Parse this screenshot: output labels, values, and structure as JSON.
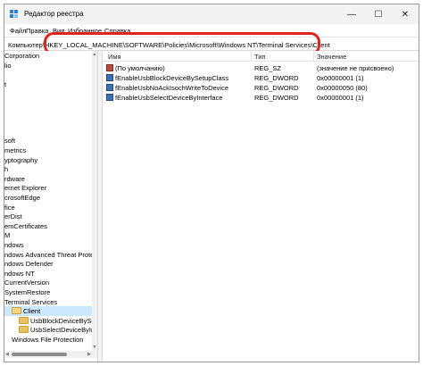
{
  "window": {
    "title": "Редактор реестра",
    "min_glyph": "—",
    "max_glyph": "☐",
    "close_glyph": "✕",
    "icon": "registry-editor-icon"
  },
  "menu": [
    "Файл",
    "Правка",
    "Вид",
    "Избранное",
    "Справка"
  ],
  "address": {
    "value": "Компьютер\\HKEY_LOCAL_MACHINE\\SOFTWARE\\Policies\\Microsoft\\Windows NT\\Terminal Services\\Client"
  },
  "tree": {
    "items": [
      {
        "label": "Corporation"
      },
      {
        "label": "lio"
      },
      {
        "label": ""
      },
      {
        "label": "t"
      },
      {
        "label": ""
      },
      {
        "label": ""
      },
      {
        "label": ""
      },
      {
        "label": ""
      },
      {
        "label": ""
      },
      {
        "label": "soft"
      },
      {
        "label": "metrics"
      },
      {
        "label": "yptography"
      },
      {
        "label": "h"
      },
      {
        "label": "rdware"
      },
      {
        "label": "ernet Explorer"
      },
      {
        "label": "crosoftEdge"
      },
      {
        "label": "fice"
      },
      {
        "label": "erDist"
      },
      {
        "label": "emCertificates"
      },
      {
        "label": "M"
      },
      {
        "label": "ndows"
      },
      {
        "label": "ndows Advanced Threat Prote"
      },
      {
        "label": "ndows Defender"
      },
      {
        "label": "ndows NT"
      },
      {
        "label": "CurrentVersion"
      },
      {
        "label": "SystemRestore"
      },
      {
        "label": "Terminal Services"
      },
      {
        "label": "Client"
      },
      {
        "label": "UsbBlockDeviceBySetu"
      },
      {
        "label": "UsbSelectDeviceByInter"
      },
      {
        "label": "Windows File Protection"
      }
    ]
  },
  "list": {
    "columns": [
      "Имя",
      "Тип",
      "Значение"
    ],
    "rows": [
      {
        "name": "(По умолчанию)",
        "type": "REG_SZ",
        "value": "(значение не присвоено)",
        "icon": "string-value-icon"
      },
      {
        "name": "fEnableUsbBlockDeviceBySetupClass",
        "type": "REG_DWORD",
        "value": "0x00000001 (1)",
        "icon": "dword-value-icon"
      },
      {
        "name": "fEnableUsbNoAckIsochWriteToDevice",
        "type": "REG_DWORD",
        "value": "0x00000050 (80)",
        "icon": "dword-value-icon"
      },
      {
        "name": "fEnableUsbSelectDeviceByInterface",
        "type": "REG_DWORD",
        "value": "0x00000001 (1)",
        "icon": "dword-value-icon"
      }
    ]
  },
  "colors": {
    "highlight_ring": "#e0241b",
    "selection": "#cce8ff",
    "folder": "#e8c15a"
  }
}
